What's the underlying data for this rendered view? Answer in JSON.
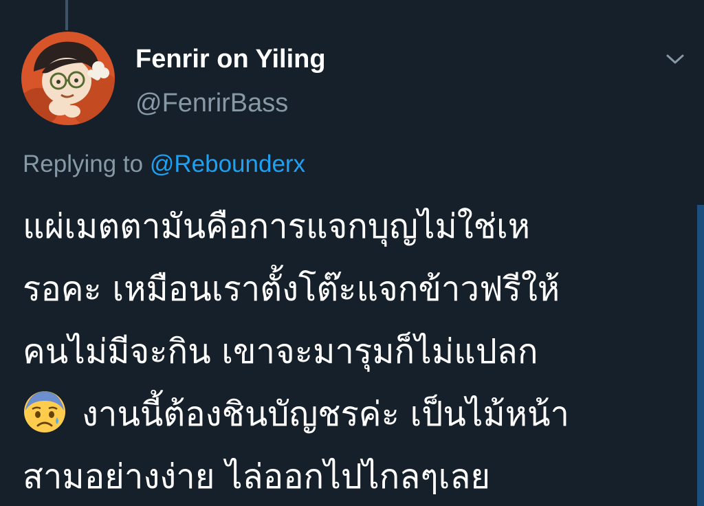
{
  "tweet": {
    "author": {
      "display_name": "Fenrir on Yiling",
      "handle": "@FenrirBass",
      "avatar_icon": "cartoon-avatar-icon"
    },
    "menu_icon": "chevron-down-icon",
    "reply": {
      "prefix": "Replying to",
      "mention": "@Rebounderx"
    },
    "text_lines": [
      "แผ่เมตตามันคือการแจกบุญไม่ใช่เห",
      "รอคะ เหมือนเราตั้งโต๊ะแจกข้าวฟรีให้",
      "คนไม่มีจะกิน เขาจะมารุมก็ไม่แปลก",
      "งานนี้ต้องชินบัญชรค่ะ เป็นไม้หน้า",
      "สามอย่างง่าย ไล่ออกไปไกลๆเลย"
    ],
    "emoji": "anxious-face-emoji"
  },
  "colors": {
    "background": "#15202b",
    "text": "#ffffff",
    "secondary": "#8899a6",
    "link": "#1da1f2"
  }
}
